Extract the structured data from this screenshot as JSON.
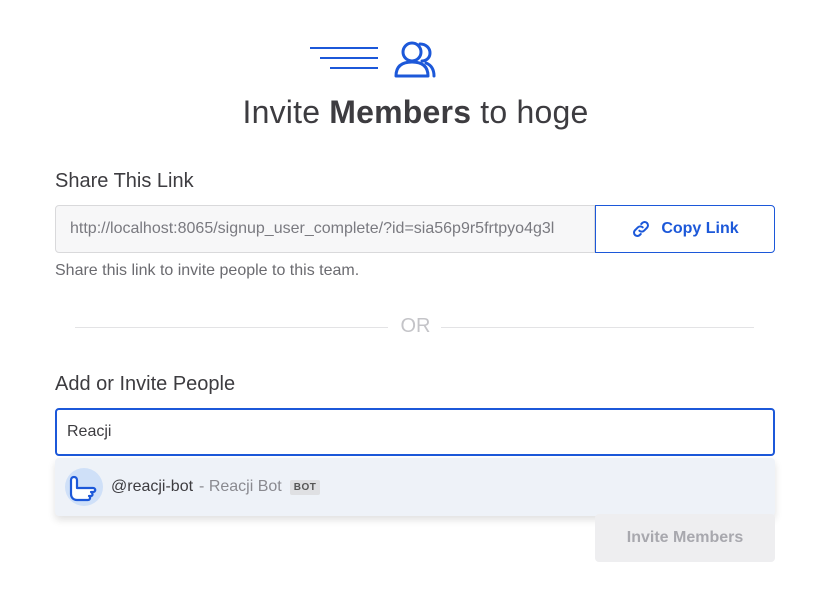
{
  "title": {
    "prefix": "Invite ",
    "bold": "Members",
    "suffix": " to hoge"
  },
  "share": {
    "label": "Share This Link",
    "link": "http://localhost:8065/signup_user_complete/?id=sia56p9r5frtpyo4g3l",
    "copy_label": "Copy Link",
    "helper": "Share this link to invite people to this team."
  },
  "divider": {
    "text": "OR"
  },
  "invite": {
    "label": "Add or Invite People",
    "input_value": "Reacji",
    "suggestion": {
      "handle": "@reacji-bot",
      "separator": " - ",
      "name": "Reacji Bot",
      "badge": "BOT"
    },
    "button_label": "Invite Members"
  },
  "colors": {
    "accent": "#1c58d9",
    "disabled_bg": "#eeeef0",
    "highlight": "#eef2f8"
  },
  "icons": {
    "header": "invite-members-icon",
    "copy": "link-icon",
    "avatar": "pointing-hand-icon"
  }
}
